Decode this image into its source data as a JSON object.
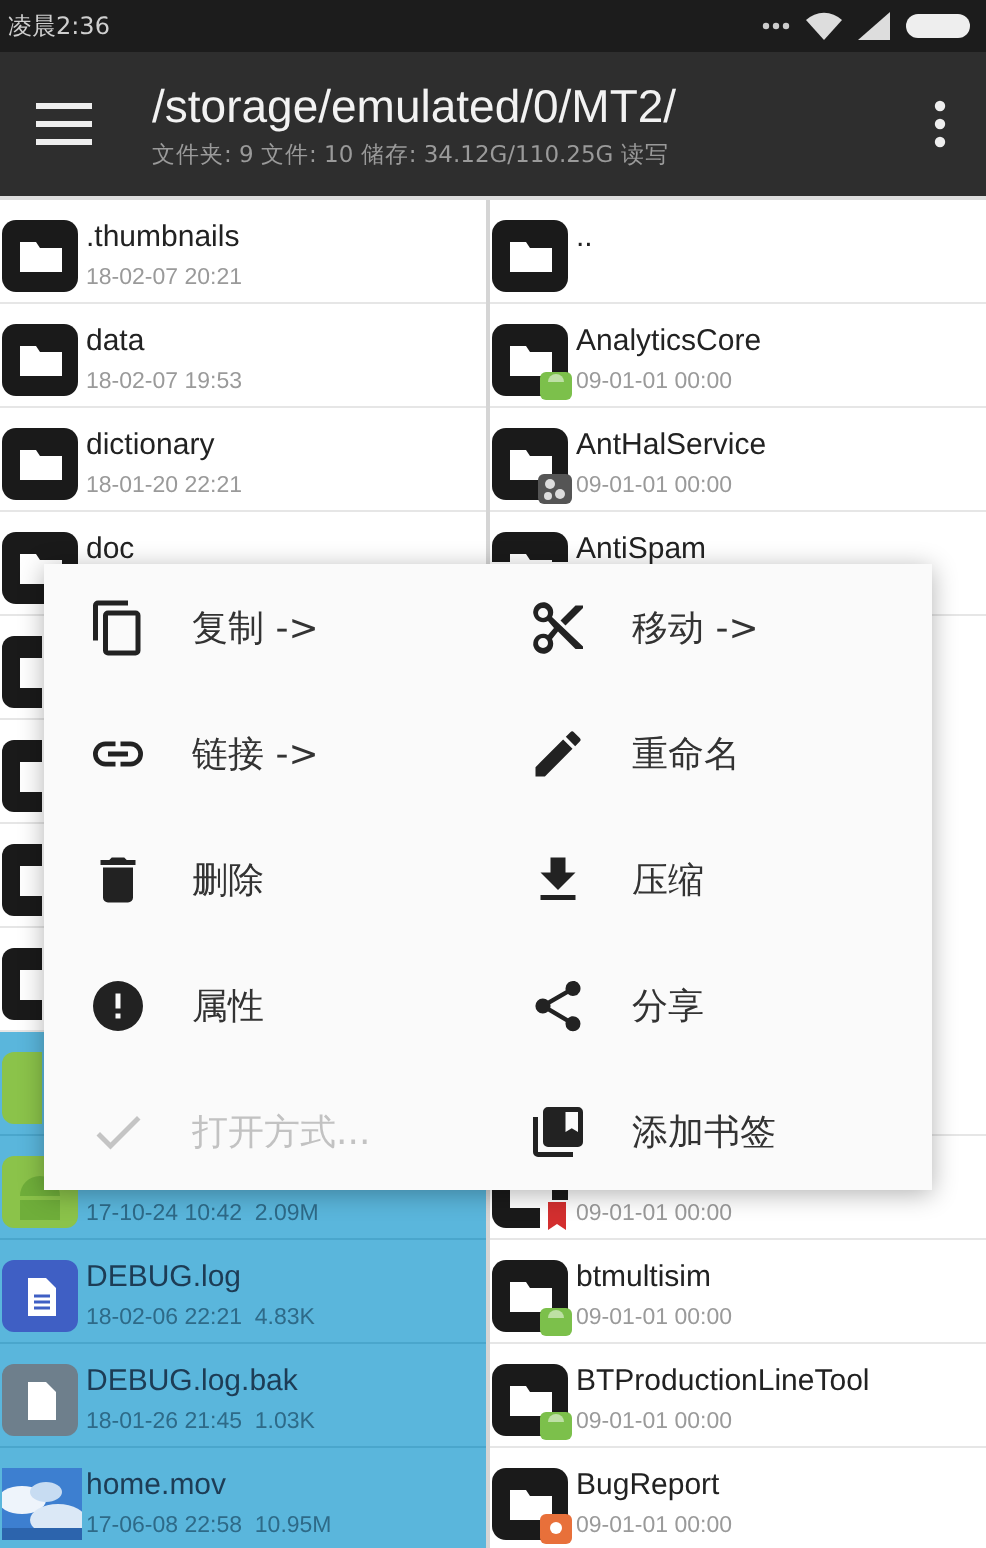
{
  "status_bar": {
    "time": "凌晨2:36"
  },
  "toolbar": {
    "title": "/storage/emulated/0/MT2/",
    "subtitle": "文件夹: 9 文件: 10 储存: 34.12G/110.25G 读写"
  },
  "left_pane": [
    {
      "kind": "folder",
      "name": ".thumbnails",
      "meta": "18-02-07 20:21",
      "selected": false
    },
    {
      "kind": "folder",
      "name": "data",
      "meta": "18-02-07 19:53",
      "selected": false
    },
    {
      "kind": "folder",
      "name": "dictionary",
      "meta": "18-01-20 22:21",
      "selected": false
    },
    {
      "kind": "folder",
      "name": "doc",
      "selected": false
    },
    {
      "kind": "folder",
      "selected": false
    },
    {
      "kind": "folder",
      "selected": false
    },
    {
      "kind": "folder",
      "selected": false
    },
    {
      "kind": "folder",
      "selected": false
    },
    {
      "kind": "apk",
      "selected": true
    },
    {
      "kind": "apk",
      "meta": "17-10-24 10:42  2.09M",
      "selected": true
    },
    {
      "kind": "doc",
      "name": "DEBUG.log",
      "meta": "18-02-06 22:21  4.83K",
      "selected": true
    },
    {
      "kind": "file",
      "name": "DEBUG.log.bak",
      "meta": "18-01-26 21:45  1.03K",
      "selected": true
    },
    {
      "kind": "video",
      "name": "home.mov",
      "meta": "17-06-08 22:58  10.95M",
      "selected": true
    }
  ],
  "right_pane": [
    {
      "kind": "folder",
      "name": "..",
      "selected": false
    },
    {
      "kind": "folder-android",
      "name": "AnalyticsCore",
      "meta": "09-01-01 00:00",
      "selected": false
    },
    {
      "kind": "folder-share",
      "name": "AntHalService",
      "meta": "09-01-01 00:00",
      "selected": false
    },
    {
      "kind": "folder",
      "name": "AntiSpam",
      "selected": false
    },
    {
      "kind": "folder-bookmark",
      "meta": "09-01-01 00:00",
      "selected": false
    },
    {
      "kind": "folder-android",
      "name": "btmultisim",
      "meta": "09-01-01 00:00",
      "selected": false
    },
    {
      "kind": "folder-android",
      "name": "BTProductionLineTool",
      "meta": "09-01-01 00:00",
      "selected": false
    },
    {
      "kind": "folder-bug",
      "name": "BugReport",
      "meta": "09-01-01 00:00",
      "selected": false
    }
  ],
  "context_menu": [
    {
      "kind": "copy",
      "label": "复制 ->",
      "disabled": false
    },
    {
      "kind": "scissors",
      "label": "移动 ->",
      "disabled": false
    },
    {
      "kind": "link",
      "label": "链接 ->",
      "disabled": false
    },
    {
      "kind": "pencil",
      "label": "重命名",
      "disabled": false
    },
    {
      "kind": "trash",
      "label": "删除",
      "disabled": false
    },
    {
      "kind": "download",
      "label": "压缩",
      "disabled": false
    },
    {
      "kind": "alert",
      "label": "属性",
      "disabled": false
    },
    {
      "kind": "share",
      "label": "分享",
      "disabled": false
    },
    {
      "kind": "check",
      "label": "打开方式...",
      "disabled": true
    },
    {
      "kind": "bookmark",
      "label": "添加书签",
      "disabled": false
    }
  ]
}
